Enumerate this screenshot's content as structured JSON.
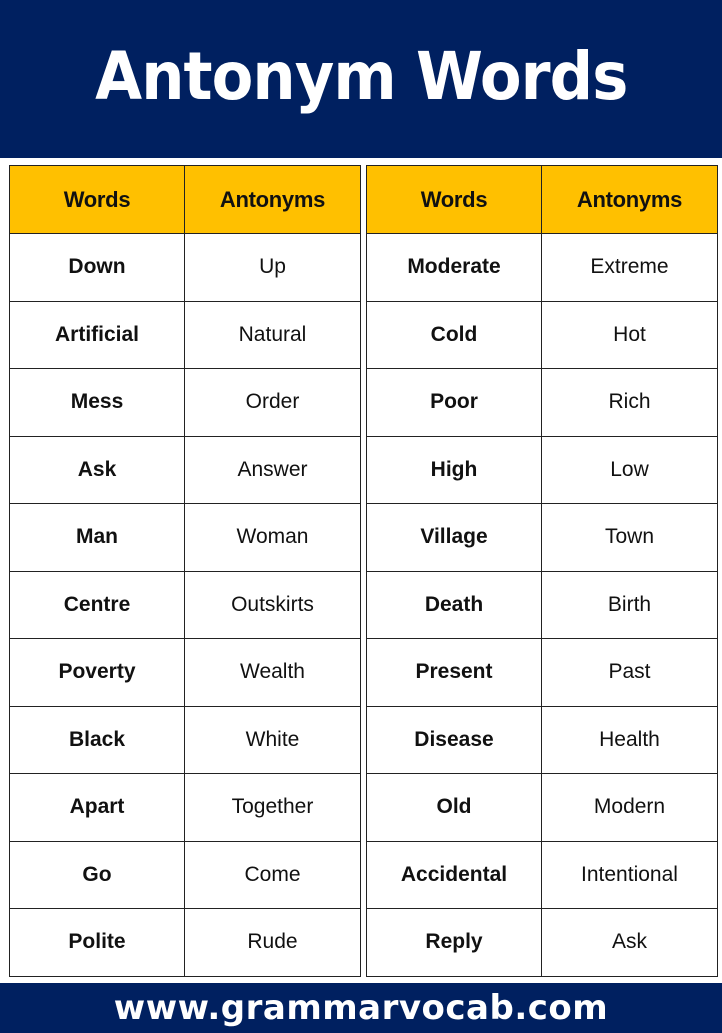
{
  "header": {
    "title": "Antonym Words"
  },
  "colors": {
    "banner": "#002060",
    "table_header": "#FFC000"
  },
  "tables": [
    {
      "columns": [
        "Words",
        "Antonyms"
      ],
      "rows": [
        [
          "Down",
          "Up"
        ],
        [
          "Artificial",
          "Natural"
        ],
        [
          "Mess",
          "Order"
        ],
        [
          "Ask",
          "Answer"
        ],
        [
          "Man",
          "Woman"
        ],
        [
          "Centre",
          "Outskirts"
        ],
        [
          "Poverty",
          "Wealth"
        ],
        [
          "Black",
          "White"
        ],
        [
          "Apart",
          "Together"
        ],
        [
          "Go",
          "Come"
        ],
        [
          "Polite",
          "Rude"
        ]
      ]
    },
    {
      "columns": [
        "Words",
        "Antonyms"
      ],
      "rows": [
        [
          "Moderate",
          "Extreme"
        ],
        [
          "Cold",
          "Hot"
        ],
        [
          "Poor",
          "Rich"
        ],
        [
          "High",
          "Low"
        ],
        [
          "Village",
          "Town"
        ],
        [
          "Death",
          "Birth"
        ],
        [
          "Present",
          "Past"
        ],
        [
          "Disease",
          "Health"
        ],
        [
          "Old",
          "Modern"
        ],
        [
          "Accidental",
          "Intentional"
        ],
        [
          "Reply",
          "Ask"
        ]
      ]
    }
  ],
  "footer": {
    "url": "www.grammarvocab.com"
  }
}
